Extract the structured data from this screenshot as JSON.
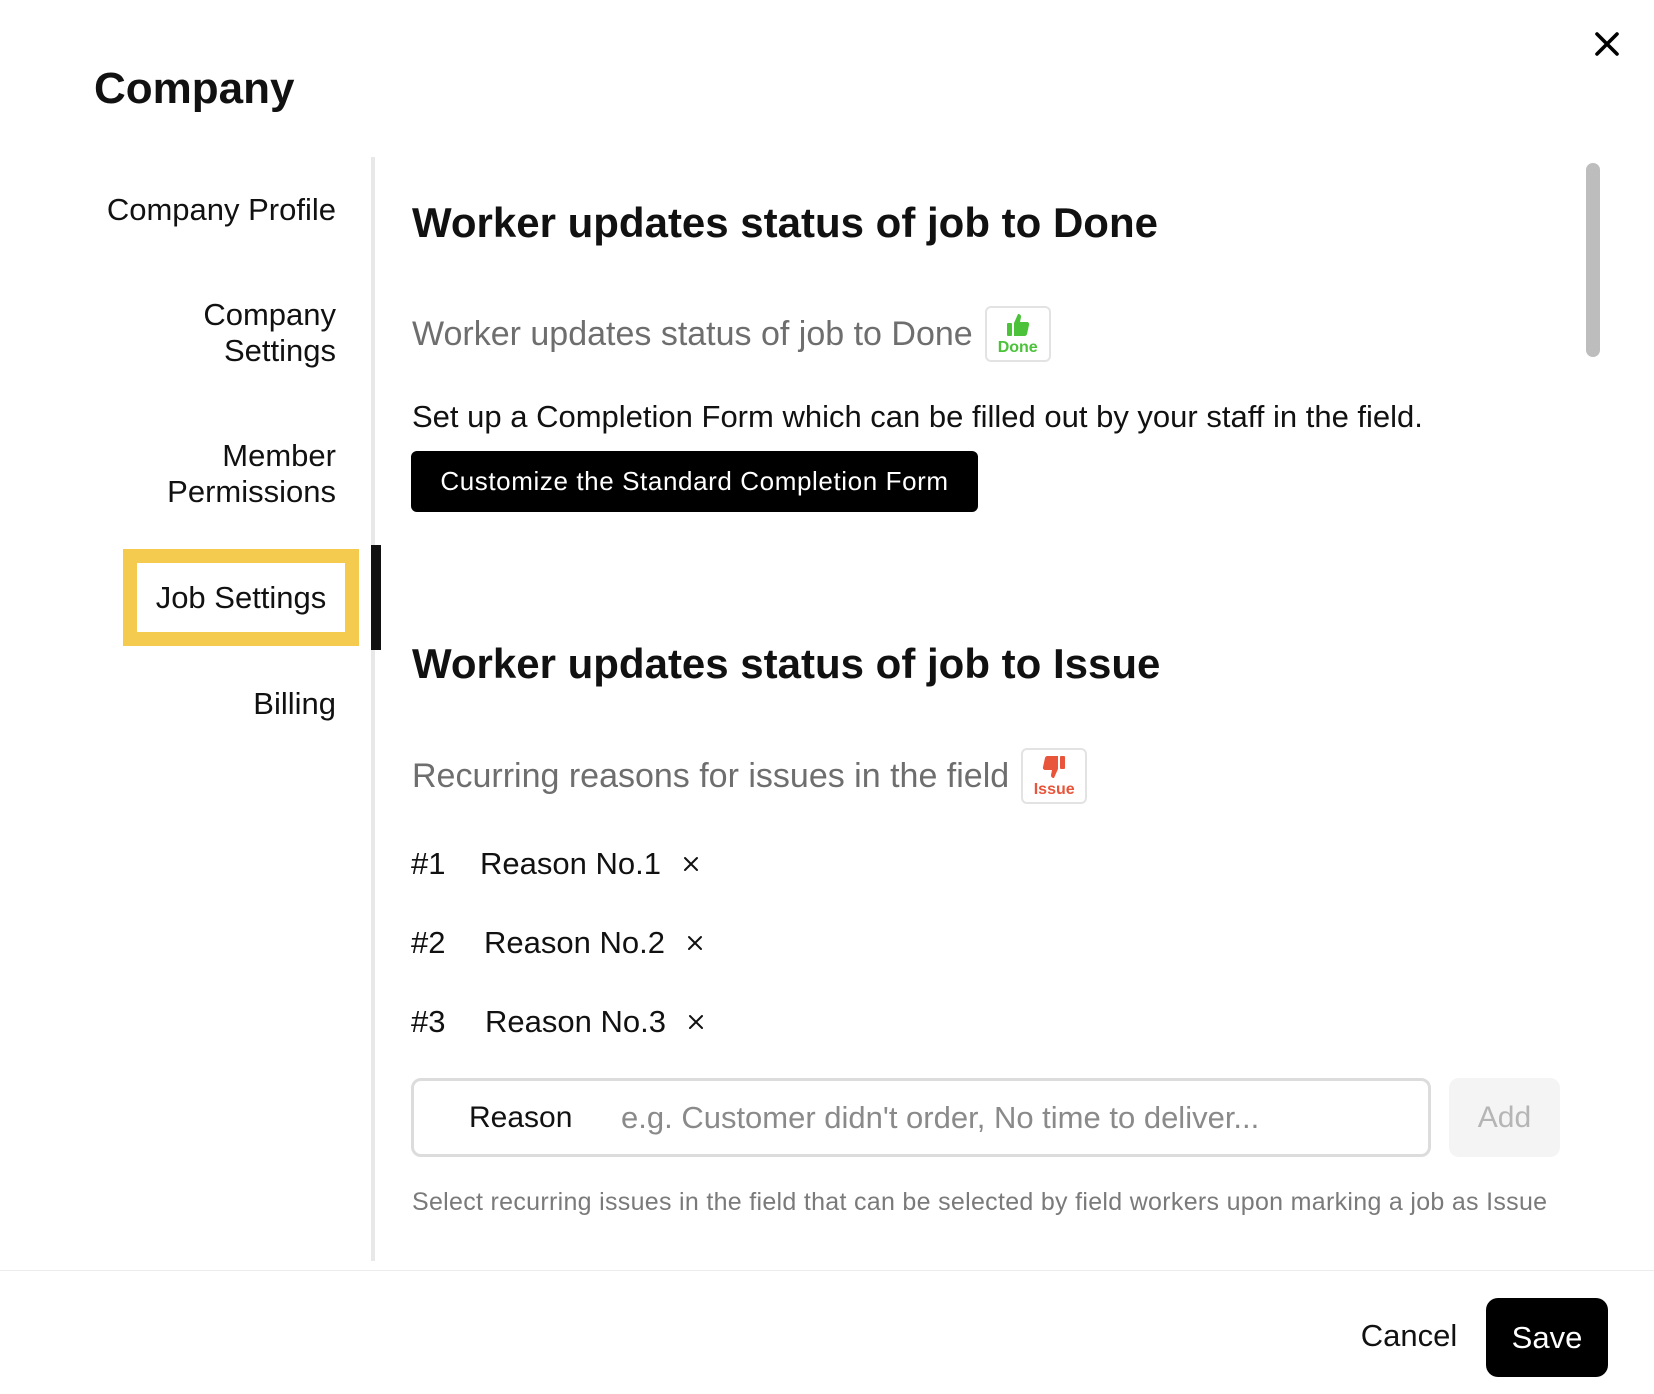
{
  "dialog": {
    "title": "Company",
    "close_icon": "close-icon"
  },
  "sidebar": {
    "items": [
      {
        "label": "Company Profile"
      },
      {
        "label_line1": "Company",
        "label_line2": "Settings"
      },
      {
        "label_line1": "Member",
        "label_line2": "Permissions"
      },
      {
        "label": "Job Settings",
        "active": true
      },
      {
        "label": "Billing"
      }
    ],
    "highlight_color": "#f5cb4f"
  },
  "done_section": {
    "heading": "Worker updates status of job to Done",
    "subtitle": "Worker updates status of job to Done",
    "badge_label": "Done",
    "badge_icon": "thumbs-up-icon",
    "badge_color": "#4cc23b",
    "description": "Set up a Completion Form which can be filled out by your staff in the field.",
    "customize_button": "Customize the Standard Completion Form"
  },
  "issue_section": {
    "heading": "Worker updates status of job to Issue",
    "subtitle": "Recurring reasons for issues in the field",
    "badge_label": "Issue",
    "badge_icon": "thumbs-down-icon",
    "badge_color": "#e8553a",
    "reasons": [
      {
        "num": "#1",
        "text": "Reason No.1"
      },
      {
        "num": "#2",
        "text": "Reason No.2"
      },
      {
        "num": "#3",
        "text": "Reason No.3"
      }
    ],
    "input_label": "Reason",
    "input_placeholder": "e.g. Customer didn't order, No time to deliver...",
    "input_value": "",
    "add_button": "Add",
    "help_text": "Select recurring issues in the field that can be selected by field workers upon marking a job as Issue"
  },
  "footer": {
    "cancel": "Cancel",
    "save": "Save"
  }
}
